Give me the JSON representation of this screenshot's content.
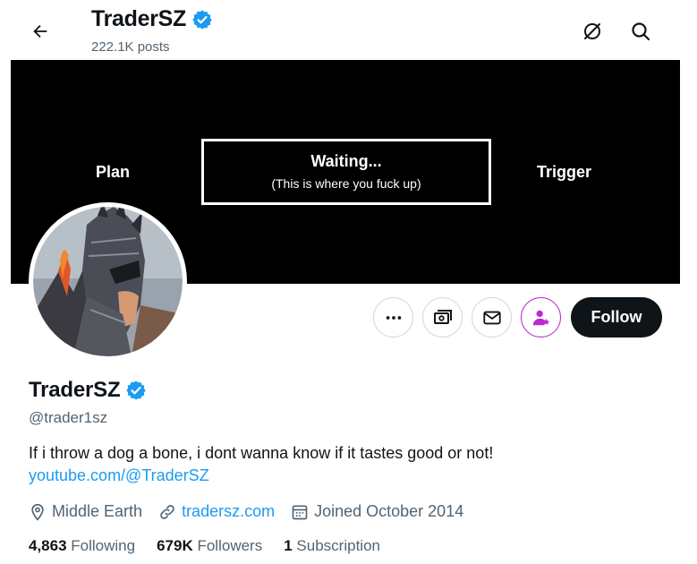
{
  "header": {
    "back_icon": "arrow-left-icon",
    "title": "TraderSZ",
    "posts": "222.1K posts",
    "icons": [
      "grok-icon",
      "search-icon"
    ]
  },
  "banner": {
    "left_label": "Plan",
    "box_title": "Waiting...",
    "box_subtitle": "(This is where you fuck up)",
    "right_label": "Trigger"
  },
  "actions": {
    "more_icon": "more-icon",
    "subscribe_icon": "money-icon",
    "message_icon": "mail-icon",
    "notify_icon": "user-star-icon",
    "follow_label": "Follow"
  },
  "profile": {
    "name": "TraderSZ",
    "handle": "@trader1sz",
    "bio": "If i throw a dog a bone, i dont wanna know if it tastes good or not!",
    "bio_link": "youtube.com/@TraderSZ",
    "location": "Middle Earth",
    "website": "tradersz.com",
    "joined": "Joined October 2014"
  },
  "stats": {
    "following_count": "4,863",
    "following_label": "Following",
    "followers_count": "679K",
    "followers_label": "Followers",
    "subscriptions_count": "1",
    "subscriptions_label": "Subscription"
  },
  "colors": {
    "accent": "#1d9bf0",
    "text": "#0f1419",
    "muted": "#536471",
    "follow_bg": "#0f1419",
    "notify_accent": "#c026d3"
  }
}
